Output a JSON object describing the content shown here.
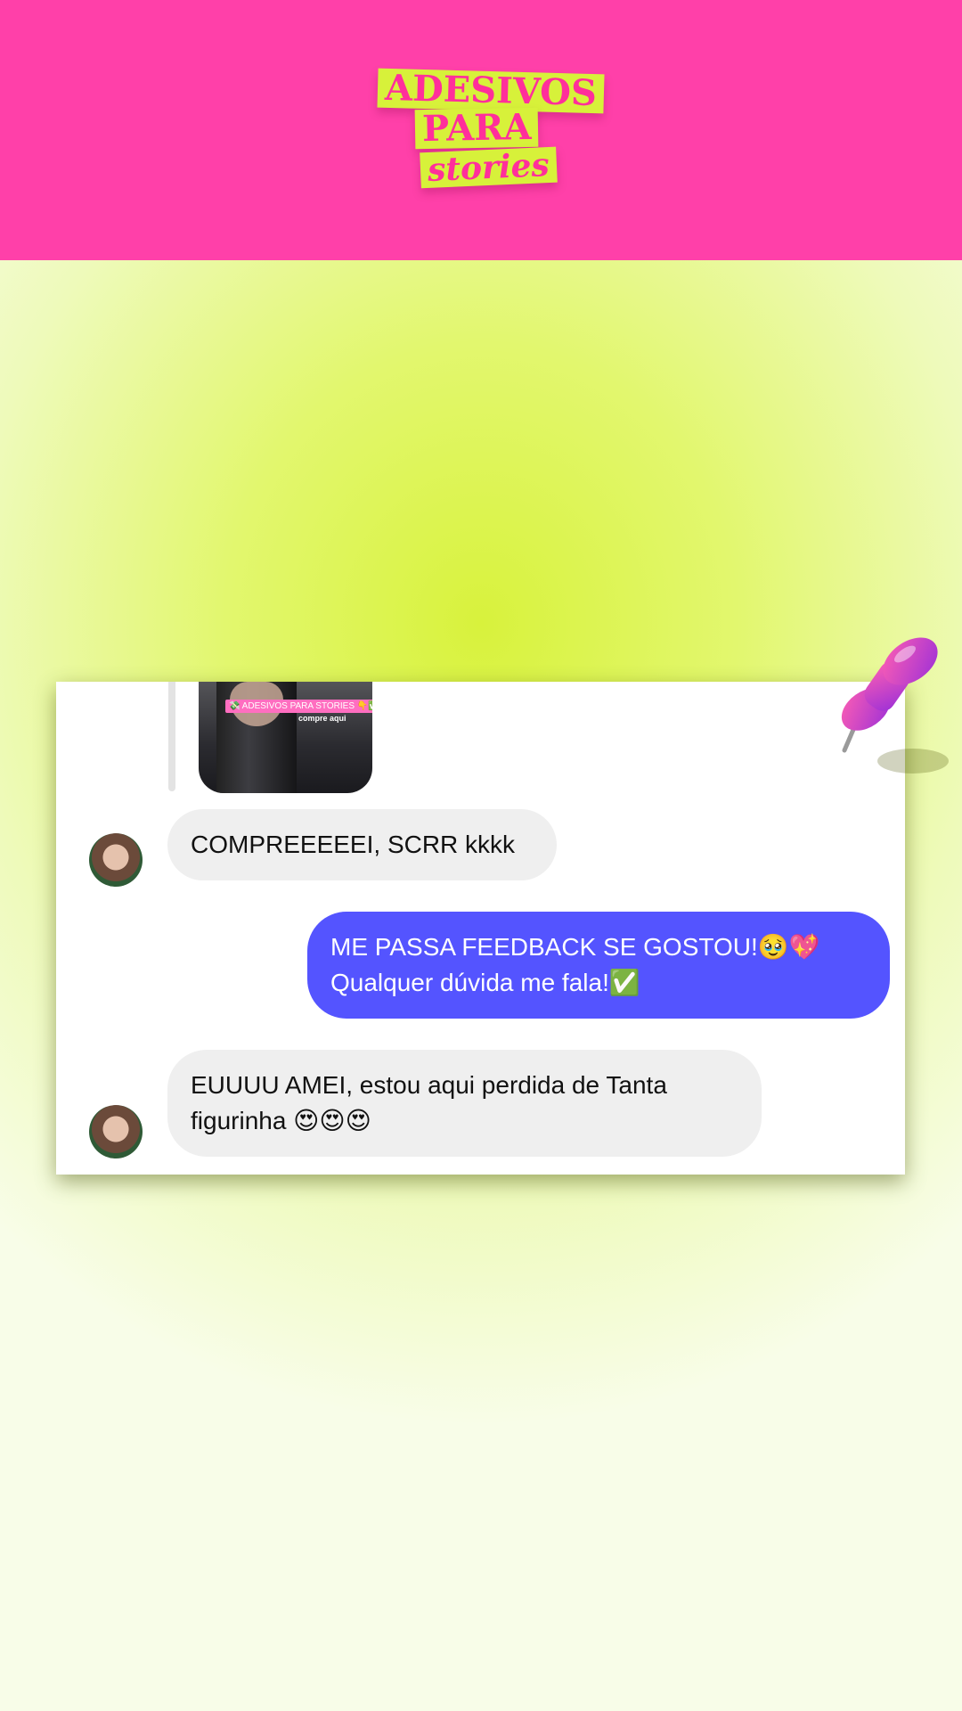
{
  "header": {
    "logo_line1": "ADESIVOS",
    "logo_line2": "PARA",
    "logo_line3": "stories"
  },
  "chat": {
    "shared_post": {
      "sticker_text": "💸 ADESIVOS PARA STORIES 👇✅",
      "sticker_subtext": "compre aqui"
    },
    "messages": [
      {
        "from": "contact",
        "text": "COMPREEEEEI, SCRR kkkk"
      },
      {
        "from": "me",
        "text": "ME PASSA FEEDBACK SE GOSTOU!🥹💖\nQualquer dúvida me fala!✅"
      },
      {
        "from": "contact",
        "text": "EUUUU AMEI, estou aqui perdida de Tanta\nfigurinha 😍😍😍"
      }
    ]
  },
  "colors": {
    "header_bg": "#ff40a9",
    "logo_bg": "#d7f13a",
    "logo_text": "#ff2f9b",
    "outgoing_bubble": "#5454ff",
    "incoming_bubble": "#efefef"
  },
  "icons": {
    "pin": "push-pin-icon",
    "avatar": "contact-avatar"
  }
}
